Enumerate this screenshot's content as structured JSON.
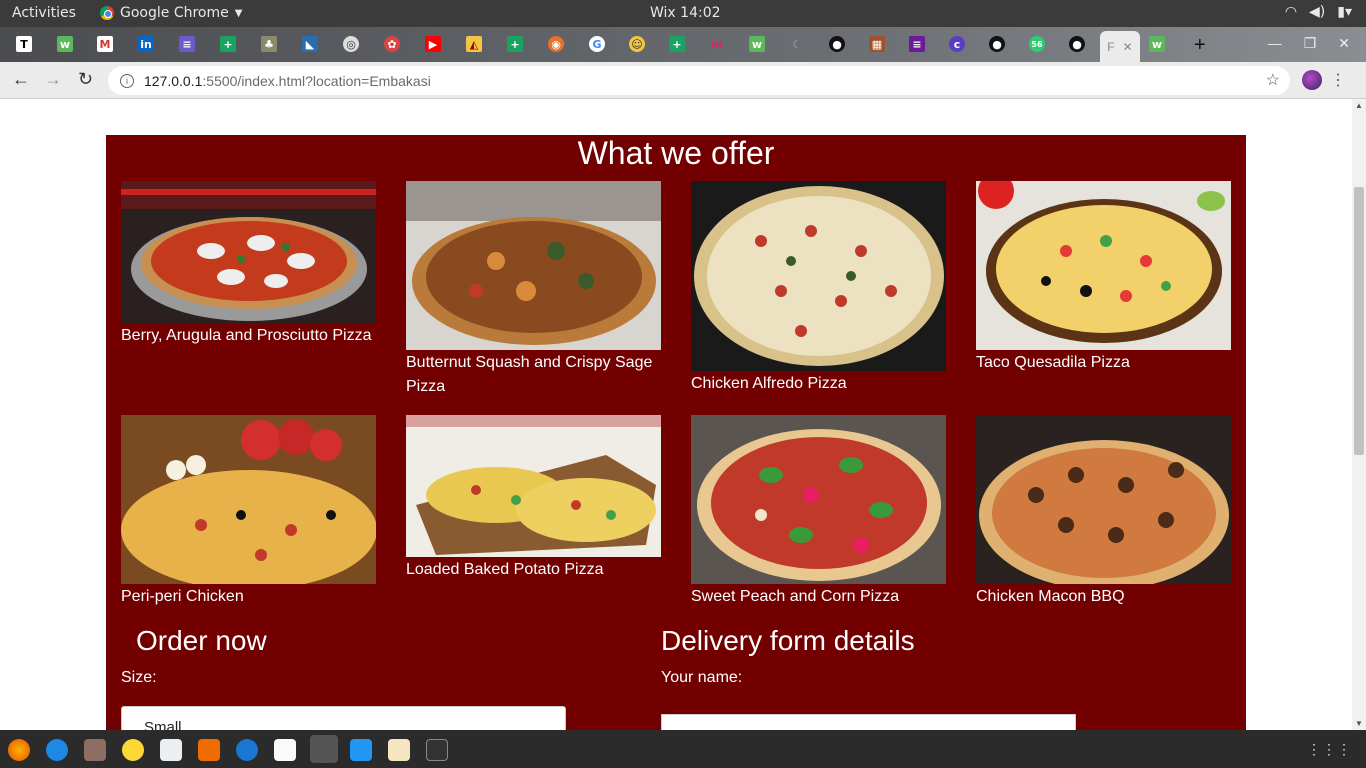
{
  "os_bar": {
    "activities": "Activities",
    "app_name": "Google Chrome",
    "clock": "Wix 14:02"
  },
  "browser": {
    "url_host": "127.0.0.1",
    "url_rest": ":5500/index.html?location=Embakasi",
    "active_tab_label": "F"
  },
  "offer": {
    "title": "What we offer",
    "items": [
      {
        "caption": "Berry, Arugula and Prosciutto Pizza"
      },
      {
        "caption": "Butternut Squash and Crispy Sage Pizza"
      },
      {
        "caption": "Chicken Alfredo Pizza"
      },
      {
        "caption": "Taco Quesadila Pizza"
      },
      {
        "caption": "Peri-peri Chicken"
      },
      {
        "caption": "Loaded Baked Potato Pizza"
      },
      {
        "caption": "Sweet Peach and Corn Pizza"
      },
      {
        "caption": "Chicken Macon BBQ"
      }
    ]
  },
  "order": {
    "title": "Order now",
    "size_label": "Size:",
    "size_value": "Small"
  },
  "delivery": {
    "title": "Delivery form details",
    "name_label": "Your name:"
  },
  "colors": {
    "section_bg": "#720000"
  }
}
